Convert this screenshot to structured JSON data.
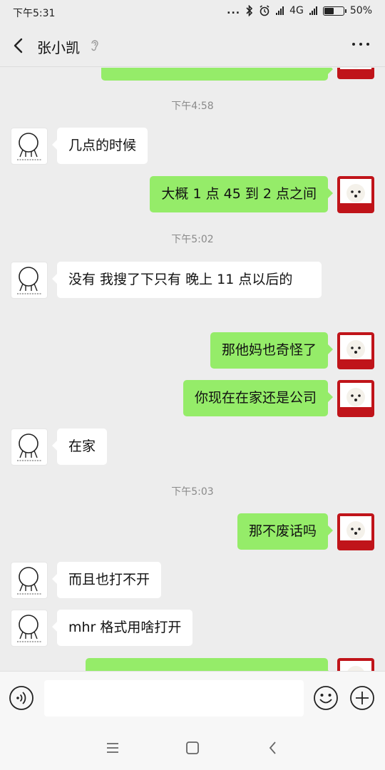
{
  "status_bar": {
    "time": "下午5:31",
    "dots": "...",
    "network": "4G",
    "battery": "50%"
  },
  "header": {
    "contact_name": "张小凯"
  },
  "timestamps": [
    "下午4:58",
    "下午5:02",
    "下午5:03"
  ],
  "messages": [
    {
      "side": "left",
      "text": "几点的时候"
    },
    {
      "side": "right",
      "text": "大概 1 点 45 到 2 点之间"
    },
    {
      "side": "left",
      "text": "没有  我搜了下只有  晚上 11 点以后的"
    },
    {
      "side": "right",
      "text": "那他妈也奇怪了"
    },
    {
      "side": "right",
      "text": "你现在在家还是公司"
    },
    {
      "side": "left",
      "text": "在家"
    },
    {
      "side": "right",
      "text": "那不废话吗"
    },
    {
      "side": "left",
      "text": "而且也打不开"
    },
    {
      "side": "left",
      "text": "mhr 格式用啥打开"
    }
  ],
  "input": {
    "value": ""
  },
  "colors": {
    "background": "#ededed",
    "sent_bubble": "#95ec69",
    "received_bubble": "#ffffff",
    "avatar_frame": "#c0141a"
  }
}
